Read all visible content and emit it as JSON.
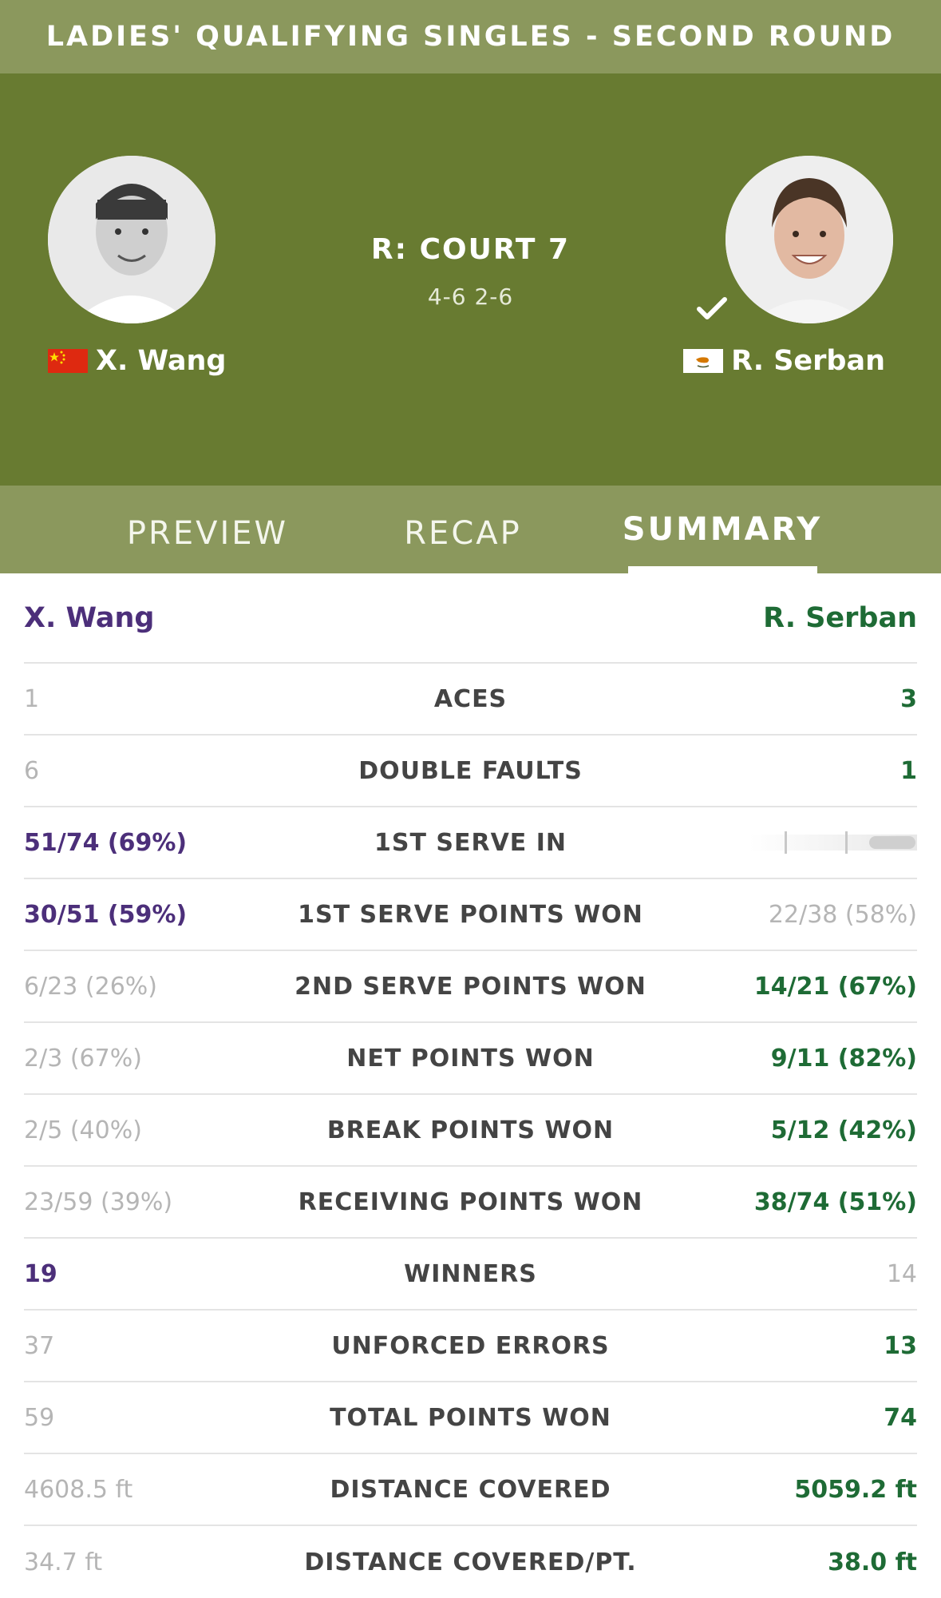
{
  "header": {
    "title": "LADIES' QUALIFYING SINGLES - SECOND ROUND"
  },
  "match": {
    "court": "R: COURT 7",
    "score": "4-6 2-6",
    "player1": {
      "name": "X. Wang",
      "flag": "china-flag-icon"
    },
    "player2": {
      "name": "R. Serban",
      "flag": "cyprus-flag-icon",
      "winner": true
    }
  },
  "tabs": [
    {
      "label": "PREVIEW",
      "active": false
    },
    {
      "label": "RECAP",
      "active": false
    },
    {
      "label": "SUMMARY",
      "active": true
    }
  ],
  "stats": {
    "player1_name": "X. Wang",
    "player2_name": "R. Serban",
    "rows": [
      {
        "label": "ACES",
        "p1": "1",
        "p2": "3",
        "leader": "p2"
      },
      {
        "label": "DOUBLE FAULTS",
        "p1": "6",
        "p2": "1",
        "leader": "p2"
      },
      {
        "label": "1ST SERVE IN",
        "p1": "51/74 (69%)",
        "p2": "",
        "leader": "p1"
      },
      {
        "label": "1ST SERVE POINTS WON",
        "p1": "30/51 (59%)",
        "p2": "22/38 (58%)",
        "leader": "p1"
      },
      {
        "label": "2ND SERVE POINTS WON",
        "p1": "6/23 (26%)",
        "p2": "14/21 (67%)",
        "leader": "p2"
      },
      {
        "label": "NET POINTS WON",
        "p1": "2/3 (67%)",
        "p2": "9/11 (82%)",
        "leader": "p2"
      },
      {
        "label": "BREAK POINTS WON",
        "p1": "2/5 (40%)",
        "p2": "5/12 (42%)",
        "leader": "p2"
      },
      {
        "label": "RECEIVING POINTS WON",
        "p1": "23/59 (39%)",
        "p2": "38/74 (51%)",
        "leader": "p2"
      },
      {
        "label": "WINNERS",
        "p1": "19",
        "p2": "14",
        "leader": "p1"
      },
      {
        "label": "UNFORCED ERRORS",
        "p1": "37",
        "p2": "13",
        "leader": "p2"
      },
      {
        "label": "TOTAL POINTS WON",
        "p1": "59",
        "p2": "74",
        "leader": "p2"
      },
      {
        "label": "DISTANCE COVERED",
        "p1": "4608.5 ft",
        "p2": "5059.2 ft",
        "leader": "p2"
      },
      {
        "label": "DISTANCE COVERED/PT.",
        "p1": "34.7 ft",
        "p2": "38.0 ft",
        "leader": "p2"
      }
    ]
  },
  "colors": {
    "header_bg": "#8b985d",
    "hero_bg": "#687b31",
    "player1": "#4c2f7a",
    "player2": "#1e6b35",
    "muted": "#b5b5b5"
  }
}
